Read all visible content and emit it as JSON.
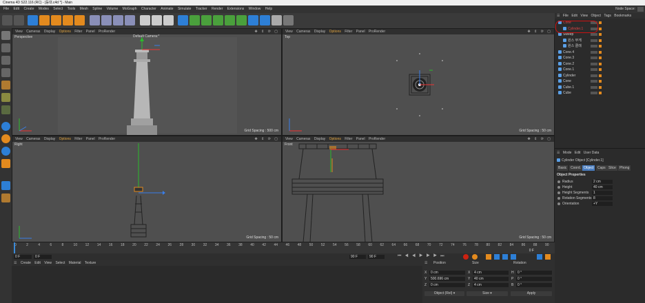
{
  "window": {
    "title": "Cinema 4D S22.116 (RC) - [등대.c4d *] - Main",
    "node_space_label": "Node Space:"
  },
  "menu": [
    "File",
    "Edit",
    "Create",
    "Modes",
    "Select",
    "Tools",
    "Mesh",
    "Spline",
    "Volume",
    "MoGraph",
    "Character",
    "Animate",
    "Simulate",
    "Tracker",
    "Render",
    "Extensions",
    "Window",
    "Help"
  ],
  "viewport_menu": [
    "View",
    "Cameras",
    "Display",
    "Options",
    "Filter",
    "Panel",
    "ProRender"
  ],
  "viewports": {
    "perspective": {
      "label": "Perspective",
      "camera": "Default Camera:*",
      "grid": "Grid Spacing : 500 cm"
    },
    "top": {
      "label": "Top",
      "grid": "Grid Spacing : 50 cm"
    },
    "right": {
      "label": "Right",
      "grid": "Grid Spacing : 50 cm"
    },
    "front": {
      "label": "Front",
      "grid": "Grid Spacing : 50 cm"
    }
  },
  "timeline": {
    "ticks": [
      "0",
      "2",
      "4",
      "6",
      "8",
      "10",
      "12",
      "14",
      "16",
      "18",
      "20",
      "22",
      "24",
      "26",
      "28",
      "30",
      "32",
      "34",
      "36",
      "38",
      "40",
      "42",
      "44",
      "46",
      "48",
      "50",
      "52",
      "54",
      "56",
      "58",
      "60",
      "62",
      "64",
      "66",
      "68",
      "70",
      "72",
      "74",
      "76",
      "78",
      "80",
      "82",
      "84",
      "86",
      "88",
      "90"
    ],
    "current_frame": "0 F",
    "start_field": "0 F",
    "field2": "0 F",
    "end_field": "90 F",
    "end_field2": "90 F"
  },
  "material_menu": [
    "Create",
    "Edit",
    "View",
    "Select",
    "Material",
    "Texture"
  ],
  "object_manager": {
    "menu": [
      "File",
      "Edit",
      "View",
      "Object",
      "Tags",
      "Bookmarks"
    ],
    "objects": [
      {
        "name": "Cone",
        "indent": 0,
        "color": "#dd4444"
      },
      {
        "name": "Cylinder.1",
        "indent": 1,
        "color": "#dd4444"
      },
      {
        "name": "Sweep",
        "indent": 0,
        "color": "#cccccc"
      },
      {
        "name": "원스 부게",
        "indent": 1,
        "color": "#cccccc"
      },
      {
        "name": "원스 클래",
        "indent": 1,
        "color": "#cccccc"
      },
      {
        "name": "Cone.4",
        "indent": 0,
        "color": "#cccccc"
      },
      {
        "name": "Cone.3",
        "indent": 0,
        "color": "#cccccc"
      },
      {
        "name": "Cone.2",
        "indent": 0,
        "color": "#cccccc"
      },
      {
        "name": "Cone.1",
        "indent": 0,
        "color": "#cccccc"
      },
      {
        "name": "Cylinder",
        "indent": 0,
        "color": "#cccccc"
      },
      {
        "name": "Cone",
        "indent": 0,
        "color": "#cccccc"
      },
      {
        "name": "Cube.1",
        "indent": 0,
        "color": "#cccccc"
      },
      {
        "name": "Cube",
        "indent": 0,
        "color": "#cccccc"
      }
    ]
  },
  "attributes": {
    "menu": [
      "Mode",
      "Edit",
      "User Data"
    ],
    "object_title": "Cylinder Object [Cylinder.1]",
    "tabs": [
      "Basic",
      "Coord.",
      "Object",
      "Caps",
      "Slice",
      "Phong"
    ],
    "active_tab": "Object",
    "section": "Object Properties",
    "props": [
      {
        "label": "Radius",
        "value": "2 cm"
      },
      {
        "label": "Height",
        "value": "40 cm"
      },
      {
        "label": "Height Segments",
        "value": "1"
      },
      {
        "label": "Rotation Segments",
        "value": "8"
      },
      {
        "label": "Orientation",
        "value": "+Y"
      }
    ]
  },
  "coordinates": {
    "headers": [
      "Position",
      "Size",
      "Rotation"
    ],
    "rows": [
      {
        "axis": "X",
        "pos": "0 cm",
        "saxis": "X",
        "size": "4 cm",
        "raxis": "H",
        "rot": "0 °"
      },
      {
        "axis": "Y",
        "pos": "500.696 cm",
        "saxis": "Y",
        "size": "40 cm",
        "raxis": "P",
        "rot": "0 °"
      },
      {
        "axis": "Z",
        "pos": "0 cm",
        "saxis": "Z",
        "size": "4 cm",
        "raxis": "B",
        "rot": "0 °"
      }
    ],
    "mode1": "Object (Rel)",
    "mode2": "Size",
    "apply": "Apply"
  },
  "colors": {
    "accent": "#e3a640",
    "selected_obj": "#dd4444",
    "highlight_circle": "#cc1111"
  }
}
